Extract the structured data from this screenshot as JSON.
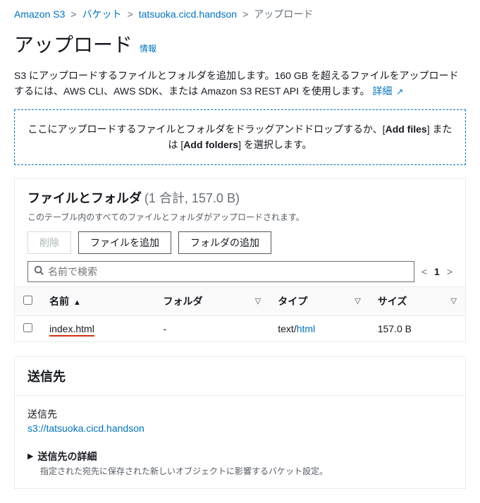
{
  "breadcrumb": {
    "items": [
      "Amazon S3",
      "バケット",
      "tatsuoka.cicd.handson",
      "アップロード"
    ]
  },
  "page": {
    "title": "アップロード",
    "info_link": "情報"
  },
  "description": {
    "text_a": "S3 にアップロードするファイルとフォルダを追加します。160 GB を超えるファイルをアップロードするには、AWS CLI、AWS SDK、または Amazon S3 REST API を使用します。",
    "details_link": "詳細"
  },
  "dropzone": {
    "pre": "ここにアップロードするファイルとフォルダをドラッグアンドドロップするか、[",
    "add_files": "Add files",
    "mid": "] または [",
    "add_folders": "Add folders",
    "post": "] を選択します。"
  },
  "files_panel": {
    "heading": "ファイルとフォルダ",
    "counter": "(1 合計, 157.0 B)",
    "subtext": "このテーブル内のすべてのファイルとフォルダがアップロードされます。",
    "btn_delete": "削除",
    "btn_add_files": "ファイルを追加",
    "btn_add_folder": "フォルダの追加",
    "search_placeholder": "名前で検索",
    "page_number": "1",
    "columns": {
      "name": "名前",
      "folder": "フォルダ",
      "type": "タイプ",
      "size": "サイズ"
    },
    "rows": [
      {
        "name": "index.html",
        "folder": "-",
        "type_pre": "text/",
        "type_link": "html",
        "size": "157.0 B"
      }
    ]
  },
  "destination": {
    "heading": "送信先",
    "label": "送信先",
    "uri": "s3://tatsuoka.cicd.handson",
    "detail_title": "送信先の詳細",
    "detail_sub": "指定された宛先に保存された新しいオブジェクトに影響するバケット設定。"
  }
}
